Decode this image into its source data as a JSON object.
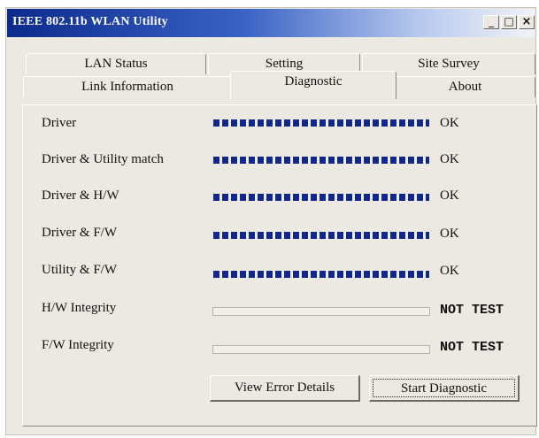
{
  "window": {
    "title": "IEEE 802.11b WLAN Utility",
    "minimize": "_",
    "maximize": "□",
    "close": "×"
  },
  "tabs": {
    "back": [
      "LAN Status",
      "Setting",
      "Site Survey"
    ],
    "front": [
      "Link Information",
      "Diagnostic",
      "About"
    ],
    "active": "Diagnostic"
  },
  "diagnostics": [
    {
      "label": "Driver",
      "progress": 1.0,
      "status": "OK"
    },
    {
      "label": "Driver & Utility match",
      "progress": 1.0,
      "status": "OK"
    },
    {
      "label": "Driver & H/W",
      "progress": 1.0,
      "status": "OK"
    },
    {
      "label": "Driver & F/W",
      "progress": 1.0,
      "status": "OK"
    },
    {
      "label": "Utility & F/W",
      "progress": 1.0,
      "status": "OK"
    },
    {
      "label": "H/W Integrity",
      "progress": 0.0,
      "status": "NOT TEST"
    },
    {
      "label": "F/W Integrity",
      "progress": 0.0,
      "status": "NOT TEST"
    }
  ],
  "buttons": {
    "view_errors": "View Error Details",
    "start": "Start Diagnostic"
  },
  "colors": {
    "progress_fill": "#10288e",
    "title_start": "#0c2a8c",
    "face": "#ece9e2"
  }
}
